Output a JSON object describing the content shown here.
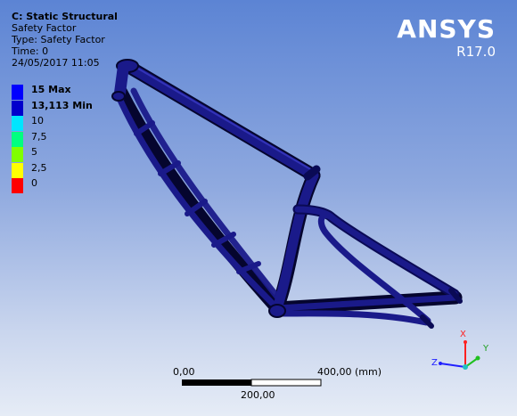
{
  "header": {
    "title": "C: Static Structural",
    "result": "Safety Factor",
    "type": "Type: Safety Factor",
    "time": "Time: 0",
    "date": "24/05/2017 11:05"
  },
  "logo": {
    "brand": "ANSYS",
    "version": "R17.0"
  },
  "legend": {
    "items": [
      {
        "label": "15 Max",
        "bold": true,
        "color": "#0000ff"
      },
      {
        "label": "13,113 Min",
        "bold": true,
        "color": "#0000cc"
      },
      {
        "label": "10",
        "bold": false,
        "color": "#00e5ff"
      },
      {
        "label": "7,5",
        "bold": false,
        "color": "#00ff80"
      },
      {
        "label": "5",
        "bold": false,
        "color": "#80ff00"
      },
      {
        "label": "2,5",
        "bold": false,
        "color": "#ffff00"
      },
      {
        "label": "0",
        "bold": false,
        "color": "#ff0000"
      }
    ]
  },
  "scale_bar": {
    "left_label": "0,00",
    "right_label": "400,00 (mm)",
    "mid_label": "200,00"
  },
  "triad": {
    "x": "X",
    "y": "Y",
    "z": "Z"
  },
  "model_color": "#1a1a8a"
}
